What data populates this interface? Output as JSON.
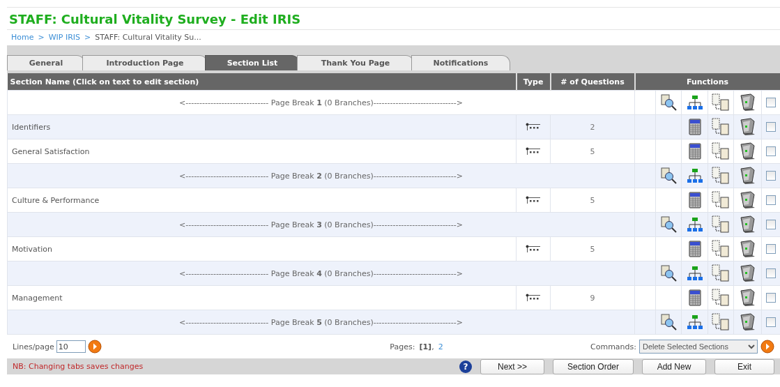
{
  "page_title": "STAFF: Cultural Vitality Survey - Edit IRIS",
  "breadcrumb": [
    {
      "label": "Home",
      "link": true
    },
    {
      "label": "WIP IRIS",
      "link": true
    },
    {
      "label": "STAFF: Cultural Vitality Su...",
      "link": false
    }
  ],
  "breadcrumb_separators": [
    ">",
    ">"
  ],
  "tabs": [
    {
      "label": "General",
      "selected": false
    },
    {
      "label": "Introduction Page",
      "selected": false
    },
    {
      "label": "Section List",
      "selected": true
    },
    {
      "label": "Thank You Page",
      "selected": false
    },
    {
      "label": "Notifications",
      "selected": false
    }
  ],
  "table": {
    "columns": [
      "Section Name (Click on text to edit section)",
      "Type",
      "# of Questions",
      "Functions"
    ],
    "rows": [
      {
        "kind": "page_break",
        "label": "<------------------------------ Page Break **1** (0 Branches)------------------------------>",
        "checked": false
      },
      {
        "kind": "section",
        "name": "Identifiers",
        "questions": "2",
        "checked": false
      },
      {
        "kind": "section",
        "name": "General Satisfaction",
        "questions": "5",
        "checked": false
      },
      {
        "kind": "page_break",
        "label": "<------------------------------ Page Break **2** (0 Branches)------------------------------>",
        "checked": false
      },
      {
        "kind": "section",
        "name": "Culture & Performance",
        "questions": "5",
        "checked": false
      },
      {
        "kind": "page_break",
        "label": "<------------------------------ Page Break **3** (0 Branches)------------------------------>",
        "checked": false
      },
      {
        "kind": "section",
        "name": "Motivation",
        "questions": "5",
        "checked": false
      },
      {
        "kind": "page_break",
        "label": "<------------------------------ Page Break **4** (0 Branches)------------------------------>",
        "checked": false
      },
      {
        "kind": "section",
        "name": "Management",
        "questions": "9",
        "checked": false
      },
      {
        "kind": "page_break",
        "label": "<------------------------------ Page Break **5** (0 Branches)------------------------------>",
        "checked": false
      }
    ]
  },
  "footer": {
    "lines_label": "Lines/page",
    "lines_value": "10",
    "pages_label": "Pages:",
    "pages": [
      {
        "label": "[1]",
        "selected": true
      },
      {
        "label": "2",
        "selected": false
      }
    ],
    "page_separator": ",",
    "commands_label": "Commands:",
    "command_value": "Delete Selected Sections"
  },
  "notice": "NB: Changing tabs saves changes",
  "help_label": "?",
  "buttons": [
    "Next >>",
    "Section Order",
    "Add New",
    "Exit"
  ]
}
